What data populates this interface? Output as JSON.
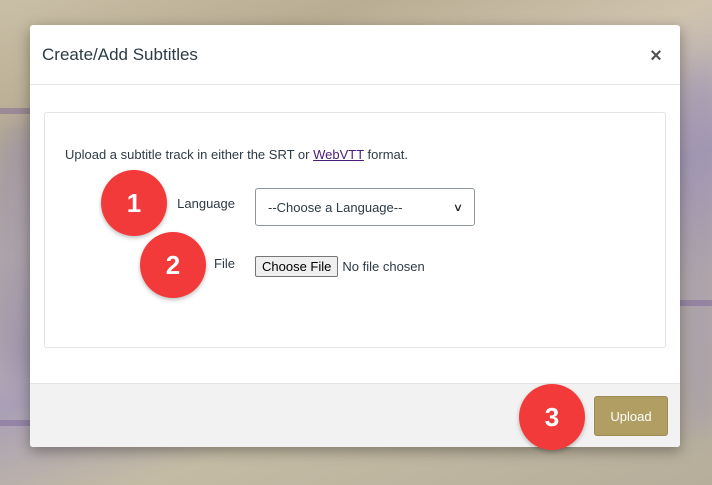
{
  "dialog": {
    "title": "Create/Add Subtitles",
    "close_label": "×"
  },
  "form": {
    "intro_before": "Upload a subtitle track in either the SRT or ",
    "intro_link": "WebVTT",
    "intro_after": " format.",
    "language_label": "Language",
    "language_select_value": "--Choose a Language--",
    "file_label": "File",
    "file_button_label": "Choose File",
    "file_status": "No file chosen"
  },
  "footer": {
    "upload_label": "Upload"
  },
  "annotations": {
    "step1": "1",
    "step2": "2",
    "step3": "3"
  },
  "colors": {
    "upload_button": "#b09e63",
    "annotation_badge": "#f23a3a",
    "link": "#4b1a7a"
  }
}
